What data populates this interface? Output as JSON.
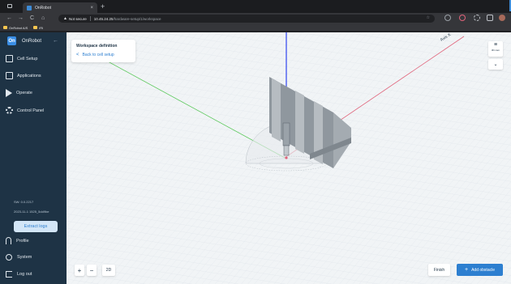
{
  "browser": {
    "tab_title": "OnRobot",
    "tab_close": "×",
    "new_tab": "+",
    "nav": {
      "back": "←",
      "forward": "→",
      "reload": "C",
      "home": "⌂"
    },
    "security_warning_icon": "warning-icon",
    "security_text": "Not secure",
    "url_host": "10.45.24.25",
    "url_path": "/hardware-setup/1/workspace",
    "bookmarks": [
      "OnRobot A/S",
      "iRi"
    ]
  },
  "sidebar": {
    "brand_logo": "On",
    "brand_name": "OnRobot",
    "collapse": "←",
    "items": [
      {
        "label": "Cell Setup"
      },
      {
        "label": "Applications"
      },
      {
        "label": "Operate"
      },
      {
        "label": "Control Panel"
      }
    ],
    "version": "SW: 0.0.2217",
    "build": "2023-11-1 1525_5dd9be",
    "extract_logs": "Extract logs",
    "profile": "Profile",
    "system": "System",
    "logout": "Log out"
  },
  "workspace": {
    "title": "Workspace definition",
    "back_label": "Back to cell setup",
    "back_chevron": "<",
    "view_label": "3D cam",
    "view_dropdown": "⌄",
    "axis_label": "Axis X",
    "zoom_in": "+",
    "zoom_out": "−",
    "mode_2d": "2D",
    "finish": "Finish",
    "add_obstacle": "Add obstacle",
    "add_icon": "+"
  },
  "colors": {
    "sidebar_bg": "#1e3345",
    "accent": "#2d7fd0",
    "extract_bg": "#d3e6f7",
    "canvas_bg": "#f1f4f6",
    "axis_x": "#e0637a",
    "axis_y": "#5cc95c",
    "axis_z": "#4a5cf0"
  }
}
